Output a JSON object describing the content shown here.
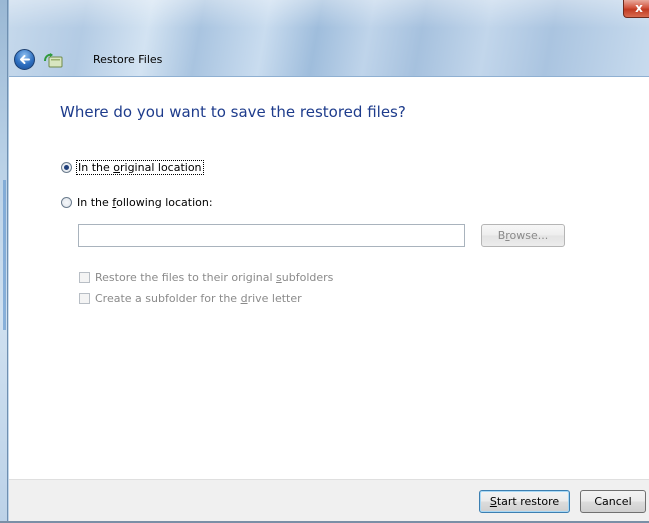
{
  "window": {
    "title": "Restore Files",
    "close_glyph": "x"
  },
  "main": {
    "heading": "Where do you want to save the restored files?",
    "options": [
      {
        "label_pre": "In the ",
        "label_accel": "o",
        "label_post": "riginal location",
        "checked": true
      },
      {
        "label_pre": "In the ",
        "label_accel": "f",
        "label_post": "ollowing location:",
        "checked": false
      }
    ],
    "location_input": {
      "value": "",
      "placeholder": ""
    },
    "browse": {
      "label_pre": "B",
      "label_accel": "r",
      "label_post": "owse..."
    },
    "checkboxes": [
      {
        "label_pre": "Restore the files to their original ",
        "label_accel": "s",
        "label_post": "ubfolders",
        "checked": false
      },
      {
        "label_pre": "Create a subfolder for the ",
        "label_accel": "d",
        "label_post": "rive letter",
        "checked": false
      }
    ]
  },
  "footer": {
    "start": {
      "label_accel": "S",
      "label_post": "tart restore"
    },
    "cancel": {
      "label": "Cancel"
    }
  },
  "icons": {
    "back": "back-arrow-icon",
    "app": "restore-files-icon",
    "close": "close-icon"
  },
  "colors": {
    "heading": "#1e3c8c",
    "titlebar": "#b3cbe4",
    "close": "#c03a22",
    "footer": "#f0f0f0"
  }
}
